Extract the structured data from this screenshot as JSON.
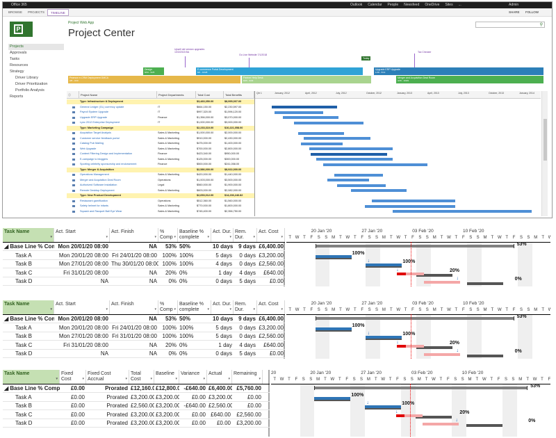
{
  "o365": {
    "title": "Office 365",
    "nav": [
      "Outlook",
      "Calendar",
      "People",
      "Newsfeed",
      "OneDrive",
      "Sites",
      "..."
    ],
    "user": "Admin"
  },
  "ribbon": {
    "tabs": [
      "BROWSE",
      "PROJECTS",
      "TIMELINE"
    ],
    "selected": 2,
    "share": "SHARE",
    "follow": "FOLLOW"
  },
  "app": {
    "subtitle": "Project Web App",
    "title": "Project Center",
    "search_placeholder": ""
  },
  "sidebar": [
    {
      "label": "Projects",
      "active": true,
      "sub": false
    },
    {
      "label": "Approvals",
      "sub": false
    },
    {
      "label": "Tasks",
      "sub": false
    },
    {
      "label": "Resources",
      "sub": false
    },
    {
      "label": "Strategy",
      "sub": false
    },
    {
      "label": "Driver Library",
      "sub": true
    },
    {
      "label": "Driver Prioritization",
      "sub": true
    },
    {
      "label": "Portfolio Analysis",
      "sub": true
    },
    {
      "label": "Reports",
      "sub": false
    }
  ],
  "timeline": {
    "callouts": [
      "Upsell old version upgrades 10/3/2015 BA",
      "Go Live Website 7/1/2018",
      "Tax Checker"
    ],
    "today": "Today",
    "bars": [
      {
        "label": "Design",
        "dates": "8/23 - 9/25",
        "color": "#4caf50"
      },
      {
        "label": "E-commerce Portal Development",
        "dates": "8/2 - 10/28",
        "color": "#2fa3d6"
      },
      {
        "label": "Upgrade ERP Upgrade",
        "dates": "1/18 - 5/13",
        "color": "#2c7fb8"
      },
      {
        "label": "Pearson e-CRM Deployment DMCA",
        "dates": "3/8 - 3/10",
        "color": "#e6b84a"
      },
      {
        "label": "Partner Help Desk",
        "dates": "8/25 - 9/29",
        "color": "#a9d48f"
      },
      {
        "label": "Merger and Acquisition Deal Room",
        "dates": "3/15 - 10/29",
        "color": "#4caf50"
      }
    ]
  },
  "grid": {
    "headers": [
      "Project Name",
      "Project Departments",
      "Total Cost",
      "Total Benefits"
    ],
    "rows": [
      {
        "g": true,
        "name": "Type: Infrastructure & Deployment",
        "dept": "",
        "cost": "$3,483,350.00",
        "ben": "$8,995,007.00"
      },
      {
        "name": "General Ledger (GL) currency update",
        "dept": "IT",
        "cost": "$664,150.00",
        "ben": "$2,230,597.00"
      },
      {
        "name": "Payroll System Upgrade",
        "dept": "IT",
        "cost": "$997,320.00",
        "ben": "$1,596,120.00"
      },
      {
        "name": "Upgrade ERP Upgrade",
        "dept": "Finance",
        "cost": "$1,356,000.00",
        "ben": "$3,070,000.00"
      },
      {
        "name": "Lync 2012 Enterprise Deployment",
        "dept": "IT",
        "cost": "$1,000,000.00",
        "ben": "$3,000,000.00"
      },
      {
        "g": true,
        "name": "Type: Marketing Campaign",
        "dept": "",
        "cost": "$2,233,310.00",
        "ben": "$10,221,058.00"
      },
      {
        "name": "Acquisition Target Analysis",
        "dept": "Sales & Marketing",
        "cost": "$1,000,000.00",
        "ben": "$2,000,000.00"
      },
      {
        "name": "Customer service feedback portal",
        "dept": "Sales & Marketing",
        "cost": "$910,000.00",
        "ben": "$2,430,000.00"
      },
      {
        "name": "Catalog Pub Mailing",
        "dept": "Sales & Marketing",
        "cost": "$475,000.00",
        "ben": "$1,400,000.00"
      },
      {
        "name": "Web Upgrade",
        "dept": "Sales & Marketing",
        "cost": "$700,000.00",
        "ben": "$2,800,000.00"
      },
      {
        "name": "Content Filtering Design and Implementation",
        "dept": "Finance",
        "cost": "$423,340.00",
        "ben": "$950,000.00"
      },
      {
        "name": "E-campaign to bloggers",
        "dept": "Sales & Marketing",
        "cost": "$125,000.00",
        "ben": "$300,000.00"
      },
      {
        "name": "Sporting celebrity sponsorship and endorsement",
        "dept": "Finance",
        "cost": "$500,000.00",
        "ben": "$241,058.00"
      },
      {
        "g": true,
        "name": "Type: Merger & Acquisition",
        "dept": "",
        "cost": "$2,586,000.00",
        "ben": "$8,922,000.00"
      },
      {
        "name": "Operations Management",
        "dept": "Sales & Marketing",
        "cost": "$420,000.00",
        "ben": "$1,440,000.00"
      },
      {
        "name": "Merger and Acquisition Deal Room",
        "dept": "Operations",
        "cost": "$1,003,000.00",
        "ben": "$3,500,000.00"
      },
      {
        "name": "Authorized Software Installation",
        "dept": "Legal",
        "cost": "$560,000.00",
        "ben": "$1,900,000.00"
      },
      {
        "name": "Remote Desktop Deployment",
        "dept": "Sales & Marketing",
        "cost": "$603,000.00",
        "ben": "$2,082,000.00"
      },
      {
        "g": true,
        "name": "Type: New Product Development",
        "dept": "",
        "cost": "$2,653,012.00",
        "ben": "$14,236,246.82"
      },
      {
        "name": "Restaurant gamification",
        "dept": "Operations",
        "cost": "$512,360.00",
        "ben": "$1,560,000.00"
      },
      {
        "name": "Safety helmet for infants",
        "dept": "Sales & Marketing",
        "cost": "$770,000.00",
        "ben": "$1,800,000.00"
      },
      {
        "name": "Squash and Racquet Ball Eye Wear",
        "dept": "Sales & Marketing",
        "cost": "$745,400.00",
        "ben": "$2,356,750.00"
      }
    ]
  },
  "gantt": {
    "periods": [
      "Qtr 1",
      "January, 2012",
      "April, 2012",
      "July, 2012",
      "October, 2012",
      "January, 2013",
      "April, 2013",
      "July, 2013",
      "October, 2013",
      "January, 2014"
    ]
  },
  "pane1": {
    "headers": [
      "Task Name",
      "Act. Start",
      "Act. Finish",
      "% Comp",
      "Baseline % complete",
      "Act. Dur.",
      "Rem. Dur.",
      "Act. Cost"
    ],
    "weeks": [
      "20 Jan '20",
      "27 Jan '20",
      "03 Feb '20",
      "10 Feb '20"
    ],
    "days": [
      "T",
      "F",
      "S",
      "S",
      "M",
      "T",
      "W",
      "T",
      "F",
      "S",
      "S",
      "M",
      "T",
      "W",
      "T",
      "F",
      "S",
      "S",
      "M",
      "T",
      "W",
      "T",
      "F",
      "S",
      "S",
      "M",
      "T",
      "W",
      "T",
      "F",
      "S",
      "S",
      "M",
      "T",
      "W",
      "T",
      "F",
      "S",
      "S"
    ],
    "rows": [
      {
        "sum": true,
        "name": "Base Line % Complete",
        "c1": "Mon 20/01/20 08:00",
        "c2": "NA",
        "c3": "53%",
        "c4": "50%",
        "c5": "10 days",
        "c6": "9 days",
        "c7": "£6,400.00",
        "pct": "53%"
      },
      {
        "name": "Task A",
        "c1": "Mon 20/01/20 08:00",
        "c2": "Fri 24/01/20 08:00",
        "c3": "100%",
        "c4": "100%",
        "c5": "5 days",
        "c6": "0 days",
        "c7": "£3,200.00",
        "pct": "100%"
      },
      {
        "name": "Task B",
        "c1": "Mon 27/01/20 08:00",
        "c2": "Thu 30/01/20 08:00",
        "c3": "100%",
        "c4": "100%",
        "c5": "4 days",
        "c6": "0 days",
        "c7": "£2,560.00",
        "pct": "100%"
      },
      {
        "name": "Task C",
        "c1": "Fri 31/01/20 08:00",
        "c2": "NA",
        "c3": "20%",
        "c4": "0%",
        "c5": "1 day",
        "c6": "4 days",
        "c7": "£640.00",
        "pct": "20%"
      },
      {
        "name": "Task D",
        "c1": "NA",
        "c2": "NA",
        "c3": "0%",
        "c4": "0%",
        "c5": "0 days",
        "c6": "5 days",
        "c7": "£0.00",
        "pct": "0%"
      }
    ]
  },
  "pane2": {
    "rows": [
      {
        "sum": true,
        "name": "Base Line % Complete",
        "c1": "Mon 20/01/20 08:00",
        "c2": "NA",
        "c3": "53%",
        "c4": "50%",
        "c5": "10 days",
        "c6": "9 days",
        "c7": "£6,400.00",
        "pct": "53%"
      },
      {
        "name": "Task A",
        "c1": "Mon 20/01/20 08:00",
        "c2": "Fri 24/01/20 08:00",
        "c3": "100%",
        "c4": "100%",
        "c5": "5 days",
        "c6": "0 days",
        "c7": "£3,200.00",
        "pct": "100%"
      },
      {
        "name": "Task B",
        "c1": "Mon 27/01/20 08:00",
        "c2": "Fri 31/01/20 08:00",
        "c3": "100%",
        "c4": "100%",
        "c5": "5 days",
        "c6": "0 days",
        "c7": "£2,560.00",
        "pct": "100%"
      },
      {
        "name": "Task C",
        "c1": "Fri 31/01/20 08:00",
        "c2": "NA",
        "c3": "20%",
        "c4": "0%",
        "c5": "1 day",
        "c6": "4 days",
        "c7": "£640.00",
        "pct": "20%"
      },
      {
        "name": "Task D",
        "c1": "NA",
        "c2": "NA",
        "c3": "0%",
        "c4": "0%",
        "c5": "0 days",
        "c6": "5 days",
        "c7": "£0.00",
        "pct": "0%"
      }
    ]
  },
  "pane3": {
    "headers": [
      "Task Name",
      "Fixed Cost",
      "Fixed Cost Accrual",
      "Total Cost",
      "Baseline",
      "Variance",
      "Actual",
      "Remaining"
    ],
    "weeks": [
      "20",
      "20 Jan '20",
      "27 Jan '20",
      "03 Feb '20",
      "10 Feb '20"
    ],
    "rows": [
      {
        "sum": true,
        "name": "Base Line % Complete",
        "c1": "£0.00",
        "c2": "Prorated",
        "c3": "£12,160.00",
        "c4": "£12,800.00",
        "c5": "-£640.00",
        "c6": "£6,400.00",
        "c7": "£5,760.00",
        "pct": "53%"
      },
      {
        "name": "Task A",
        "c1": "£0.00",
        "c2": "Prorated",
        "c3": "£3,200.00",
        "c4": "£3,200.00",
        "c5": "£0.00",
        "c6": "£3,200.00",
        "c7": "£0.00",
        "pct": "100%"
      },
      {
        "name": "Task B",
        "c1": "£0.00",
        "c2": "Prorated",
        "c3": "£2,560.00",
        "c4": "£3,200.00",
        "c5": "-£640.00",
        "c6": "£2,560.00",
        "c7": "£0.00",
        "pct": "100%"
      },
      {
        "name": "Task C",
        "c1": "£0.00",
        "c2": "Prorated",
        "c3": "£3,200.00",
        "c4": "£3,200.00",
        "c5": "£0.00",
        "c6": "£640.00",
        "c7": "£2,560.00",
        "pct": "20%"
      },
      {
        "name": "Task D",
        "c1": "£0.00",
        "c2": "Prorated",
        "c3": "£3,200.00",
        "c4": "£3,200.00",
        "c5": "£0.00",
        "c6": "£0.00",
        "c7": "£3,200.00",
        "pct": "0%"
      }
    ]
  }
}
